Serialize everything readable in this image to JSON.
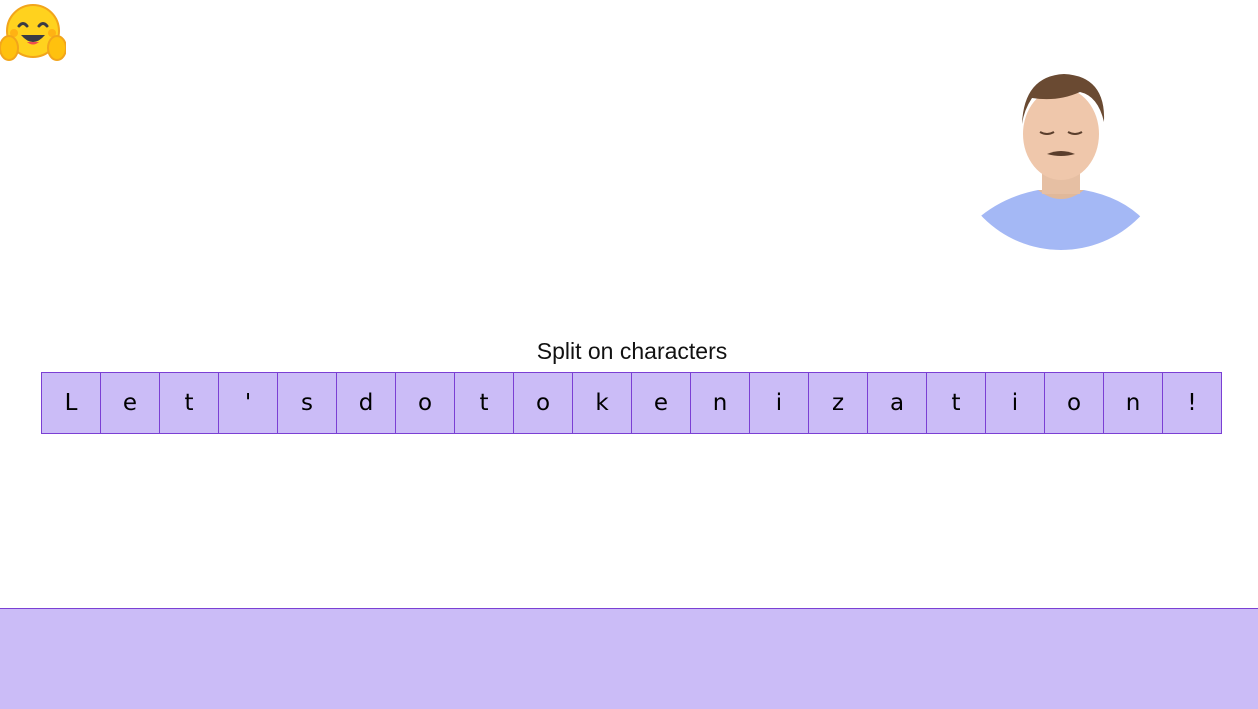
{
  "slide": {
    "title": "Split on characters",
    "tokens": [
      "L",
      "e",
      "t",
      "'",
      "s",
      "d",
      "o",
      "t",
      "o",
      "k",
      "e",
      "n",
      "i",
      "z",
      "a",
      "t",
      "i",
      "o",
      "n",
      "!"
    ]
  },
  "icons": {
    "logo": "hugging-face-emoji-icon",
    "presenter": "presenter-video-feed"
  },
  "colors": {
    "token_fill": "#cbbcf7",
    "token_border": "#7b3fd4",
    "background": "#ffffff",
    "band": "#cbbcf7"
  }
}
